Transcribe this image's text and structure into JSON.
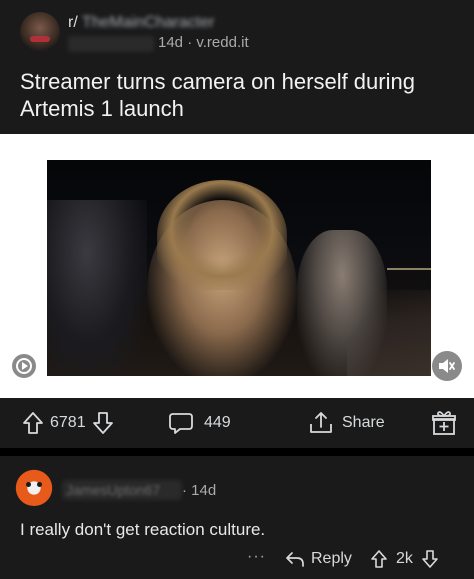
{
  "post": {
    "subreddit": "r/",
    "author": "TheMainCharacter",
    "time": "14d",
    "domain": "v.redd.it",
    "title": "Streamer turns camera on herself during Artemis 1 launch"
  },
  "actions": {
    "upvotes": "6781",
    "comments": "449",
    "share_label": "Share"
  },
  "comment": {
    "author": "JamesUpton67",
    "time": "14d",
    "body": "I really don't get reaction culture.",
    "more": "···",
    "reply_label": "Reply",
    "score": "2k"
  },
  "icons": {
    "upvote": "arrow-up-icon",
    "downvote": "arrow-down-icon",
    "comment": "speech-bubble-icon",
    "share": "share-icon",
    "award": "gift-icon",
    "reply": "reply-arrow-icon",
    "gif": "play-circle-icon",
    "mute": "speaker-muted-icon"
  },
  "colors": {
    "background": "#000000",
    "card": "#1a1a1b",
    "text": "#d7dadc",
    "muted": "#a8aaab"
  }
}
